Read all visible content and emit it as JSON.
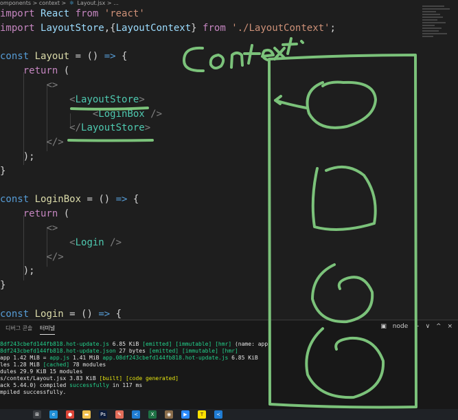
{
  "breadcrumb": {
    "items": [
      "omponents",
      "context",
      "Layout.jsx",
      "..."
    ],
    "separator": ">"
  },
  "editor": {
    "lines": [
      {
        "tokens": [
          [
            "import",
            "ctrl"
          ],
          [
            " ",
            "punc"
          ],
          [
            "React",
            "id"
          ],
          [
            " ",
            "punc"
          ],
          [
            "from",
            "ctrl"
          ],
          [
            " ",
            "punc"
          ],
          [
            "'react'",
            "str"
          ]
        ]
      },
      {
        "tokens": [
          [
            "import",
            "ctrl"
          ],
          [
            " ",
            "punc"
          ],
          [
            "LayoutStore",
            "id"
          ],
          [
            ",{",
            "punc"
          ],
          [
            "LayoutContext",
            "id"
          ],
          [
            "} ",
            "punc"
          ],
          [
            "from",
            "ctrl"
          ],
          [
            " ",
            "punc"
          ],
          [
            "'./LayoutContext'",
            "str"
          ],
          [
            ";",
            "punc"
          ]
        ]
      },
      {
        "tokens": []
      },
      {
        "tokens": [
          [
            "const",
            "kw"
          ],
          [
            " ",
            "punc"
          ],
          [
            "Layout",
            "fn"
          ],
          [
            " = () ",
            "punc"
          ],
          [
            "=>",
            "kw"
          ],
          [
            " {",
            "punc"
          ]
        ]
      },
      {
        "tokens": [
          [
            "    ",
            "punc"
          ],
          [
            "return",
            "ctrl"
          ],
          [
            " (",
            "punc"
          ]
        ]
      },
      {
        "tokens": [
          [
            "        ",
            "punc"
          ],
          [
            "<>",
            "tag"
          ]
        ]
      },
      {
        "tokens": [
          [
            "            ",
            "punc"
          ],
          [
            "<",
            "tag"
          ],
          [
            "LayoutStore",
            "comp"
          ],
          [
            ">",
            "tag"
          ]
        ]
      },
      {
        "tokens": [
          [
            "                ",
            "punc"
          ],
          [
            "<",
            "tag"
          ],
          [
            "LoginBox",
            "comp"
          ],
          [
            " />",
            "tag"
          ]
        ]
      },
      {
        "tokens": [
          [
            "            ",
            "punc"
          ],
          [
            "</",
            "tag"
          ],
          [
            "LayoutStore",
            "comp"
          ],
          [
            ">",
            "tag"
          ]
        ]
      },
      {
        "tokens": [
          [
            "        ",
            "punc"
          ],
          [
            "</>",
            "tag"
          ]
        ]
      },
      {
        "tokens": [
          [
            "    ",
            "punc"
          ],
          [
            ");",
            "punc"
          ]
        ]
      },
      {
        "tokens": [
          [
            "}",
            "punc"
          ]
        ]
      },
      {
        "tokens": []
      },
      {
        "tokens": [
          [
            "const",
            "kw"
          ],
          [
            " ",
            "punc"
          ],
          [
            "LoginBox",
            "fn"
          ],
          [
            " = () ",
            "punc"
          ],
          [
            "=>",
            "kw"
          ],
          [
            " {",
            "punc"
          ]
        ]
      },
      {
        "tokens": [
          [
            "    ",
            "punc"
          ],
          [
            "return",
            "ctrl"
          ],
          [
            " (",
            "punc"
          ]
        ]
      },
      {
        "tokens": [
          [
            "        ",
            "punc"
          ],
          [
            "<>",
            "tag"
          ]
        ]
      },
      {
        "tokens": [
          [
            "            ",
            "punc"
          ],
          [
            "<",
            "tag"
          ],
          [
            "Login",
            "comp"
          ],
          [
            " />",
            "tag"
          ]
        ]
      },
      {
        "tokens": [
          [
            "        ",
            "punc"
          ],
          [
            "</>",
            "tag"
          ]
        ]
      },
      {
        "tokens": [
          [
            "    ",
            "punc"
          ],
          [
            ");",
            "punc"
          ]
        ]
      },
      {
        "tokens": [
          [
            "}",
            "punc"
          ]
        ]
      },
      {
        "tokens": []
      },
      {
        "tokens": [
          [
            "const",
            "kw"
          ],
          [
            " ",
            "punc"
          ],
          [
            "Login",
            "fn"
          ],
          [
            " = () ",
            "punc"
          ],
          [
            "=>",
            "kw"
          ],
          [
            " {",
            "punc"
          ]
        ]
      }
    ]
  },
  "annotation": {
    "handwritten_text": "Context",
    "stroke_color": "#7bc27a"
  },
  "panel": {
    "tabs": [
      {
        "label": "디버그 콘솔",
        "active": false
      },
      {
        "label": "터미널",
        "active": true
      }
    ],
    "terminal_name": "node",
    "actions": [
      "+",
      "∨",
      "^",
      "×"
    ],
    "terminal_lines": [
      [
        [
          "8df243cbefd144fb818.hot-update.js ",
          "t-green"
        ],
        [
          "6.85 KiB ",
          "t-white"
        ],
        [
          "[emitted] [immutable] [hmr] ",
          "t-green"
        ],
        [
          "(name: app)",
          "t-white"
        ]
      ],
      [
        [
          "8df243cbefd144fb818.hot-update.json ",
          "t-green"
        ],
        [
          "27 bytes ",
          "t-white"
        ],
        [
          "[emitted] [immutable] [hmr]",
          "t-green"
        ]
      ],
      [
        [
          "app ",
          "t-white"
        ],
        [
          "1.42 MiB = ",
          "t-white"
        ],
        [
          "app.js ",
          "t-green"
        ],
        [
          "1.41 MiB ",
          "t-white"
        ],
        [
          "app.08df243cbefd144fb818.hot-update.js ",
          "t-green"
        ],
        [
          "6.85 KiB",
          "t-white"
        ]
      ],
      [
        [
          "les 1.28 MiB ",
          "t-white"
        ],
        [
          "[cached] ",
          "t-green"
        ],
        [
          "78 modules",
          "t-white"
        ]
      ],
      [
        [
          "dules 29.9 KiB 15 modules",
          "t-white"
        ]
      ],
      [
        [
          "s/context/Layout.jsx ",
          "t-white"
        ],
        [
          "3.83 KiB ",
          "t-white"
        ],
        [
          "[built] [code generated]",
          "t-yellow"
        ]
      ],
      [
        [
          "ack 5.44.0) compiled ",
          "t-white"
        ],
        [
          "successfully ",
          "t-green"
        ],
        [
          "in 117 ms",
          "t-white"
        ]
      ],
      [
        [
          "mpiled successfully.",
          "t-white"
        ]
      ]
    ]
  },
  "taskbar": {
    "icons": [
      {
        "name": "task-view-icon",
        "color": "#3a3d41",
        "glyph": "⊞"
      },
      {
        "name": "edge-icon",
        "color": "#1f8fd6",
        "glyph": "e"
      },
      {
        "name": "chrome-icon",
        "color": "#db4437",
        "glyph": "●"
      },
      {
        "name": "file-explorer-icon",
        "color": "#f2c14e",
        "glyph": "▬"
      },
      {
        "name": "photoshop-icon",
        "color": "#0b1b3a",
        "glyph": "Ps"
      },
      {
        "name": "paint-icon",
        "color": "#e26d5a",
        "glyph": "✎"
      },
      {
        "name": "vscode-icon",
        "color": "#1f7cd3",
        "glyph": "≺"
      },
      {
        "name": "excel-icon",
        "color": "#1e7145",
        "glyph": "X"
      },
      {
        "name": "camera-app-icon",
        "color": "#8a6d4b",
        "glyph": "◉"
      },
      {
        "name": "zoom-icon",
        "color": "#2d8cff",
        "glyph": "▶"
      },
      {
        "name": "kakaotalk-icon",
        "color": "#fae100",
        "glyph": "T"
      },
      {
        "name": "vscode-alt-icon",
        "color": "#1f7cd3",
        "glyph": "≺"
      }
    ]
  }
}
